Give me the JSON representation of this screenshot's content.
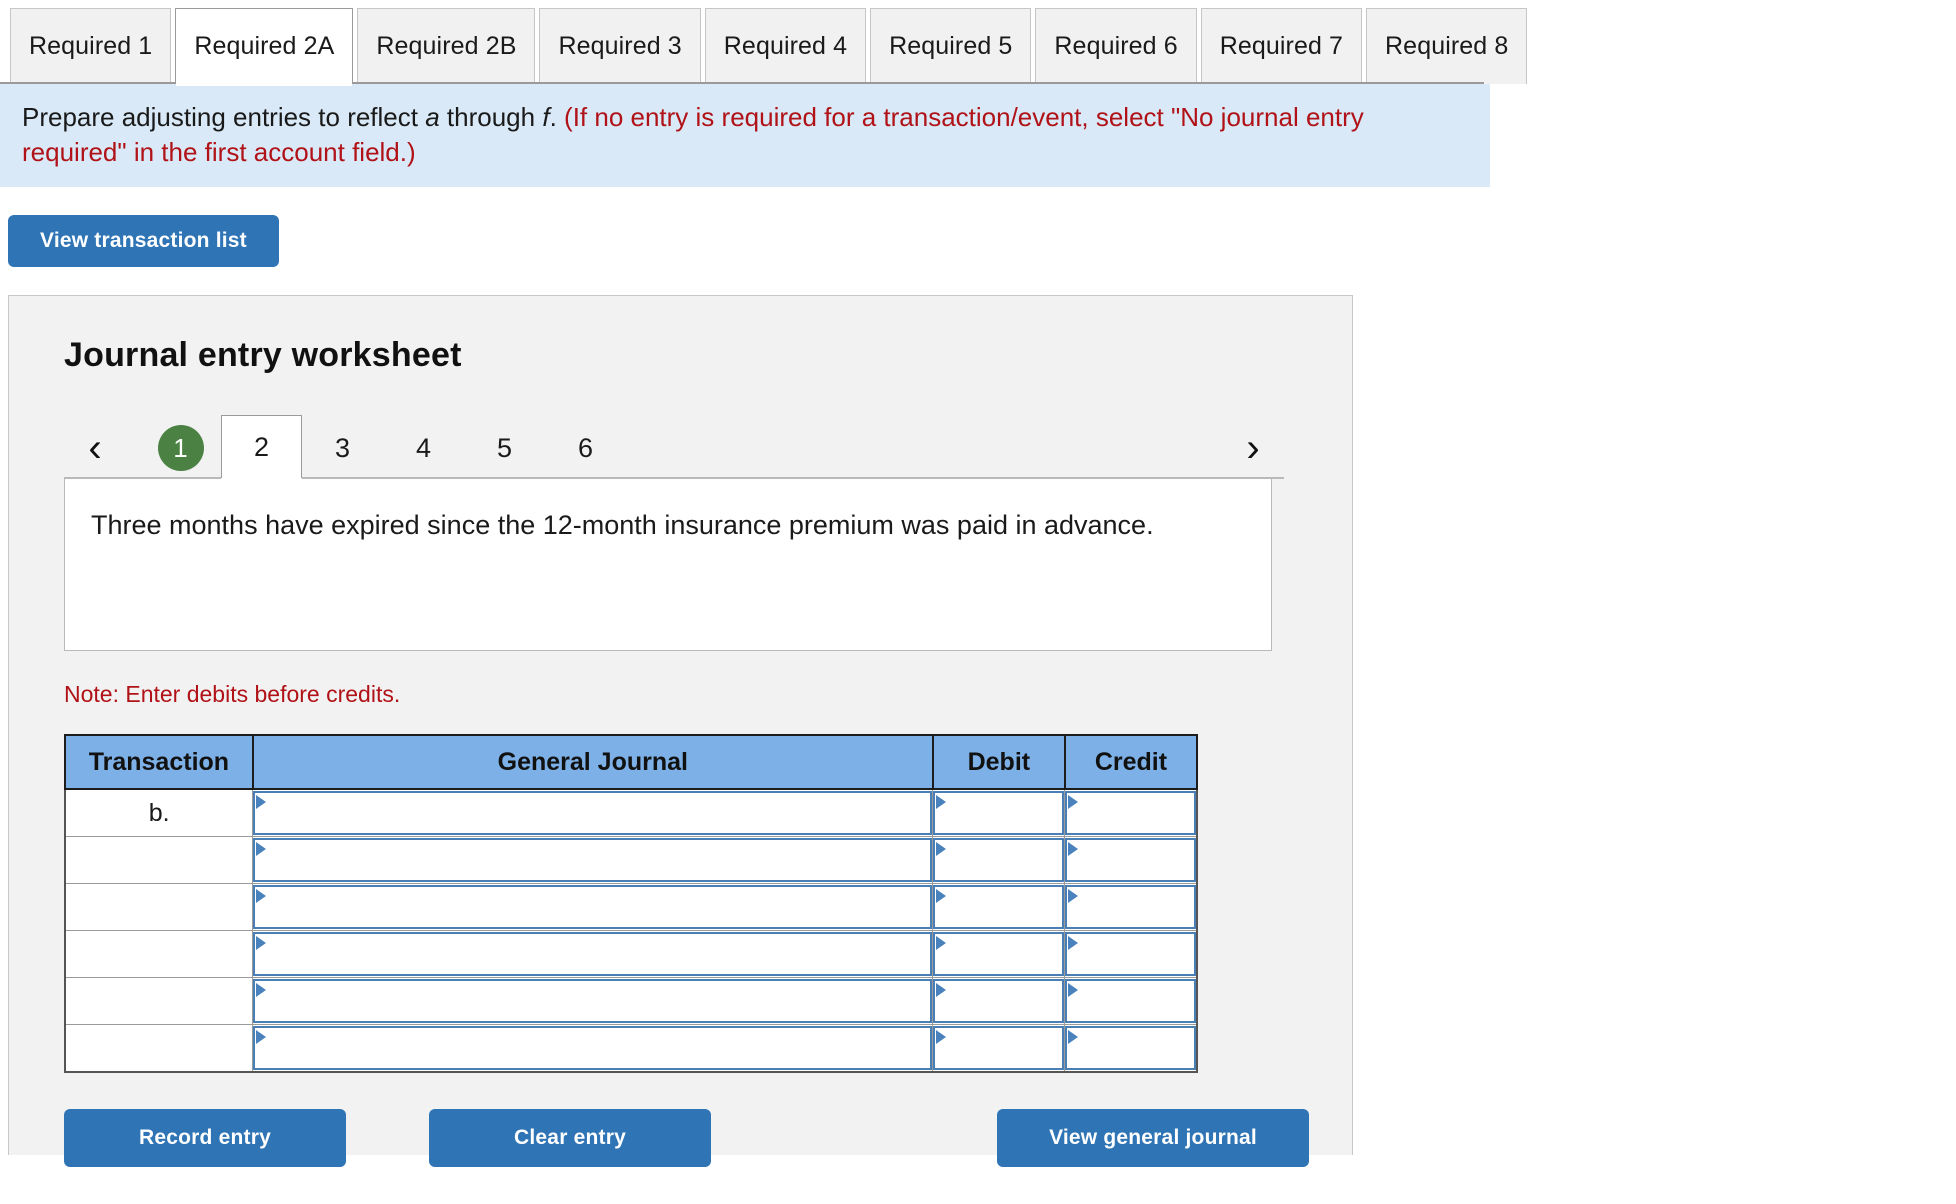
{
  "tabs": {
    "items": [
      {
        "label": "Required 1",
        "active": false
      },
      {
        "label": "Required 2A",
        "active": true
      },
      {
        "label": "Required 2B",
        "active": false
      },
      {
        "label": "Required 3",
        "active": false
      },
      {
        "label": "Required 4",
        "active": false
      },
      {
        "label": "Required 5",
        "active": false
      },
      {
        "label": "Required 6",
        "active": false
      },
      {
        "label": "Required 7",
        "active": false
      },
      {
        "label": "Required 8",
        "active": false
      }
    ]
  },
  "instruction": {
    "black_part_1": "Prepare adjusting entries to reflect ",
    "italic_a": "a",
    "black_part_2": " through ",
    "italic_f": "f",
    "black_part_3": ".",
    "red_part": "(If no entry is required for a transaction/event, select \"No journal entry required\" in the first account field.)"
  },
  "toolbar": {
    "view_transaction_list_label": "View transaction list"
  },
  "worksheet": {
    "title": "Journal entry worksheet",
    "pager": {
      "prev_icon": "chevron-left-icon",
      "next_icon": "chevron-right-icon",
      "prev_glyph": "‹",
      "next_glyph": "›",
      "pages": [
        {
          "label": "1",
          "state": "completed"
        },
        {
          "label": "2",
          "state": "active"
        },
        {
          "label": "3",
          "state": "default"
        },
        {
          "label": "4",
          "state": "default"
        },
        {
          "label": "5",
          "state": "default"
        },
        {
          "label": "6",
          "state": "default"
        }
      ]
    },
    "scenario_text": "Three months have expired since the 12-month insurance premium was paid in advance.",
    "note": "Note: Enter debits before credits.",
    "table": {
      "columns": [
        "Transaction",
        "General Journal",
        "Debit",
        "Credit"
      ],
      "rows": [
        {
          "transaction": "b.",
          "general_journal": "",
          "debit": "",
          "credit": ""
        },
        {
          "transaction": "",
          "general_journal": "",
          "debit": "",
          "credit": ""
        },
        {
          "transaction": "",
          "general_journal": "",
          "debit": "",
          "credit": ""
        },
        {
          "transaction": "",
          "general_journal": "",
          "debit": "",
          "credit": ""
        },
        {
          "transaction": "",
          "general_journal": "",
          "debit": "",
          "credit": ""
        },
        {
          "transaction": "",
          "general_journal": "",
          "debit": "",
          "credit": ""
        }
      ]
    },
    "buttons": {
      "record_entry": "Record entry",
      "clear_entry": "Clear entry",
      "view_general_journal": "View general journal"
    }
  },
  "colors": {
    "accent_blue": "#2f74b5",
    "banner_blue": "#d9e9f7",
    "table_header_blue": "#7cb0e6",
    "field_border_blue": "#4a7fb5",
    "red_text": "#b01217",
    "completed_green": "#4b8243",
    "panel_gray": "#f2f2f2"
  }
}
